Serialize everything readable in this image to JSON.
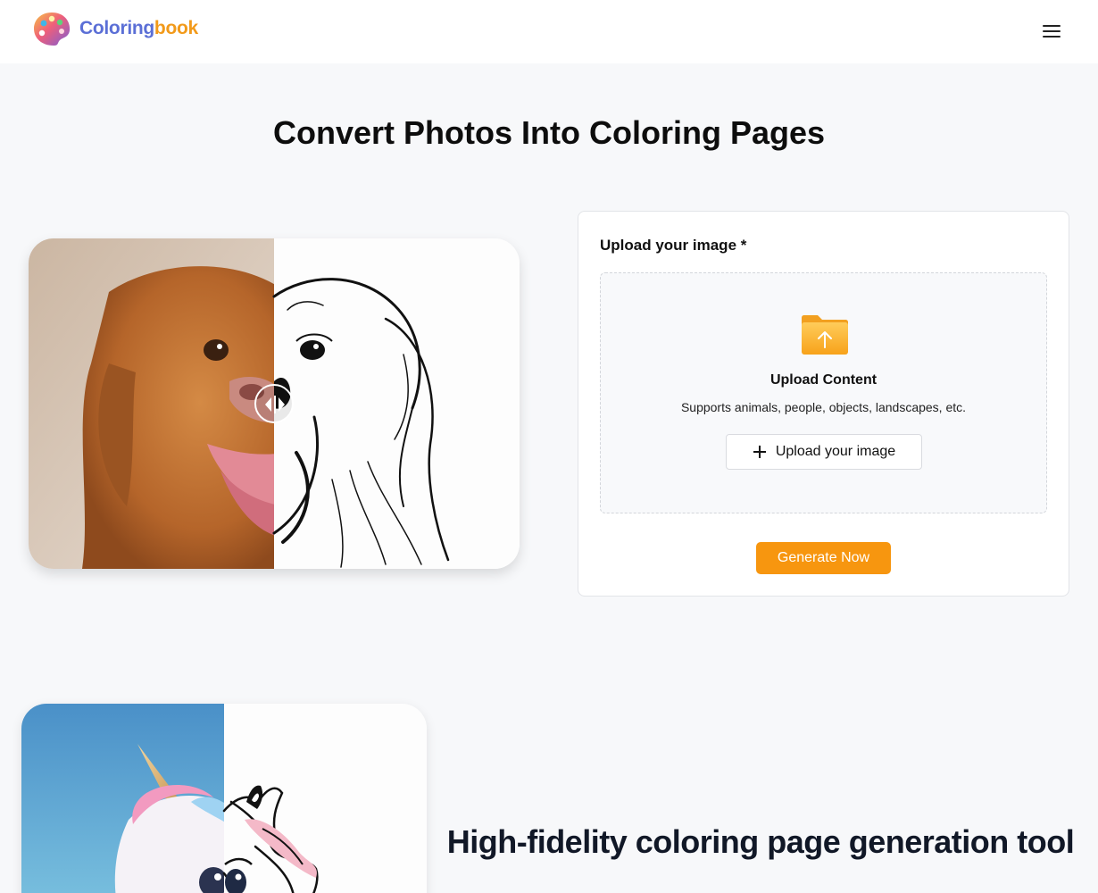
{
  "header": {
    "logo_word1": "Coloring",
    "logo_word2": "book",
    "menu_icon": "hamburger-menu-icon"
  },
  "hero": {
    "title": "Convert Photos Into Coloring Pages"
  },
  "comparison": {
    "photo_subject": "dog",
    "handle_icon": "drag-arrows-icon"
  },
  "upload": {
    "label": "Upload your image *",
    "folder_icon": "folder-upload-icon",
    "drop_title": "Upload Content",
    "drop_subtitle": "Supports animals, people, objects, landscapes, etc.",
    "button_label": "Upload your image",
    "generate_label": "Generate Now"
  },
  "feature": {
    "title": "High-fidelity coloring page generation tool"
  },
  "colors": {
    "accent": "#f7960f",
    "logo_blue": "#5b6fd6",
    "logo_orange": "#f29a1a",
    "page_bg": "#f7f8fa",
    "heading_dark": "#111827"
  }
}
